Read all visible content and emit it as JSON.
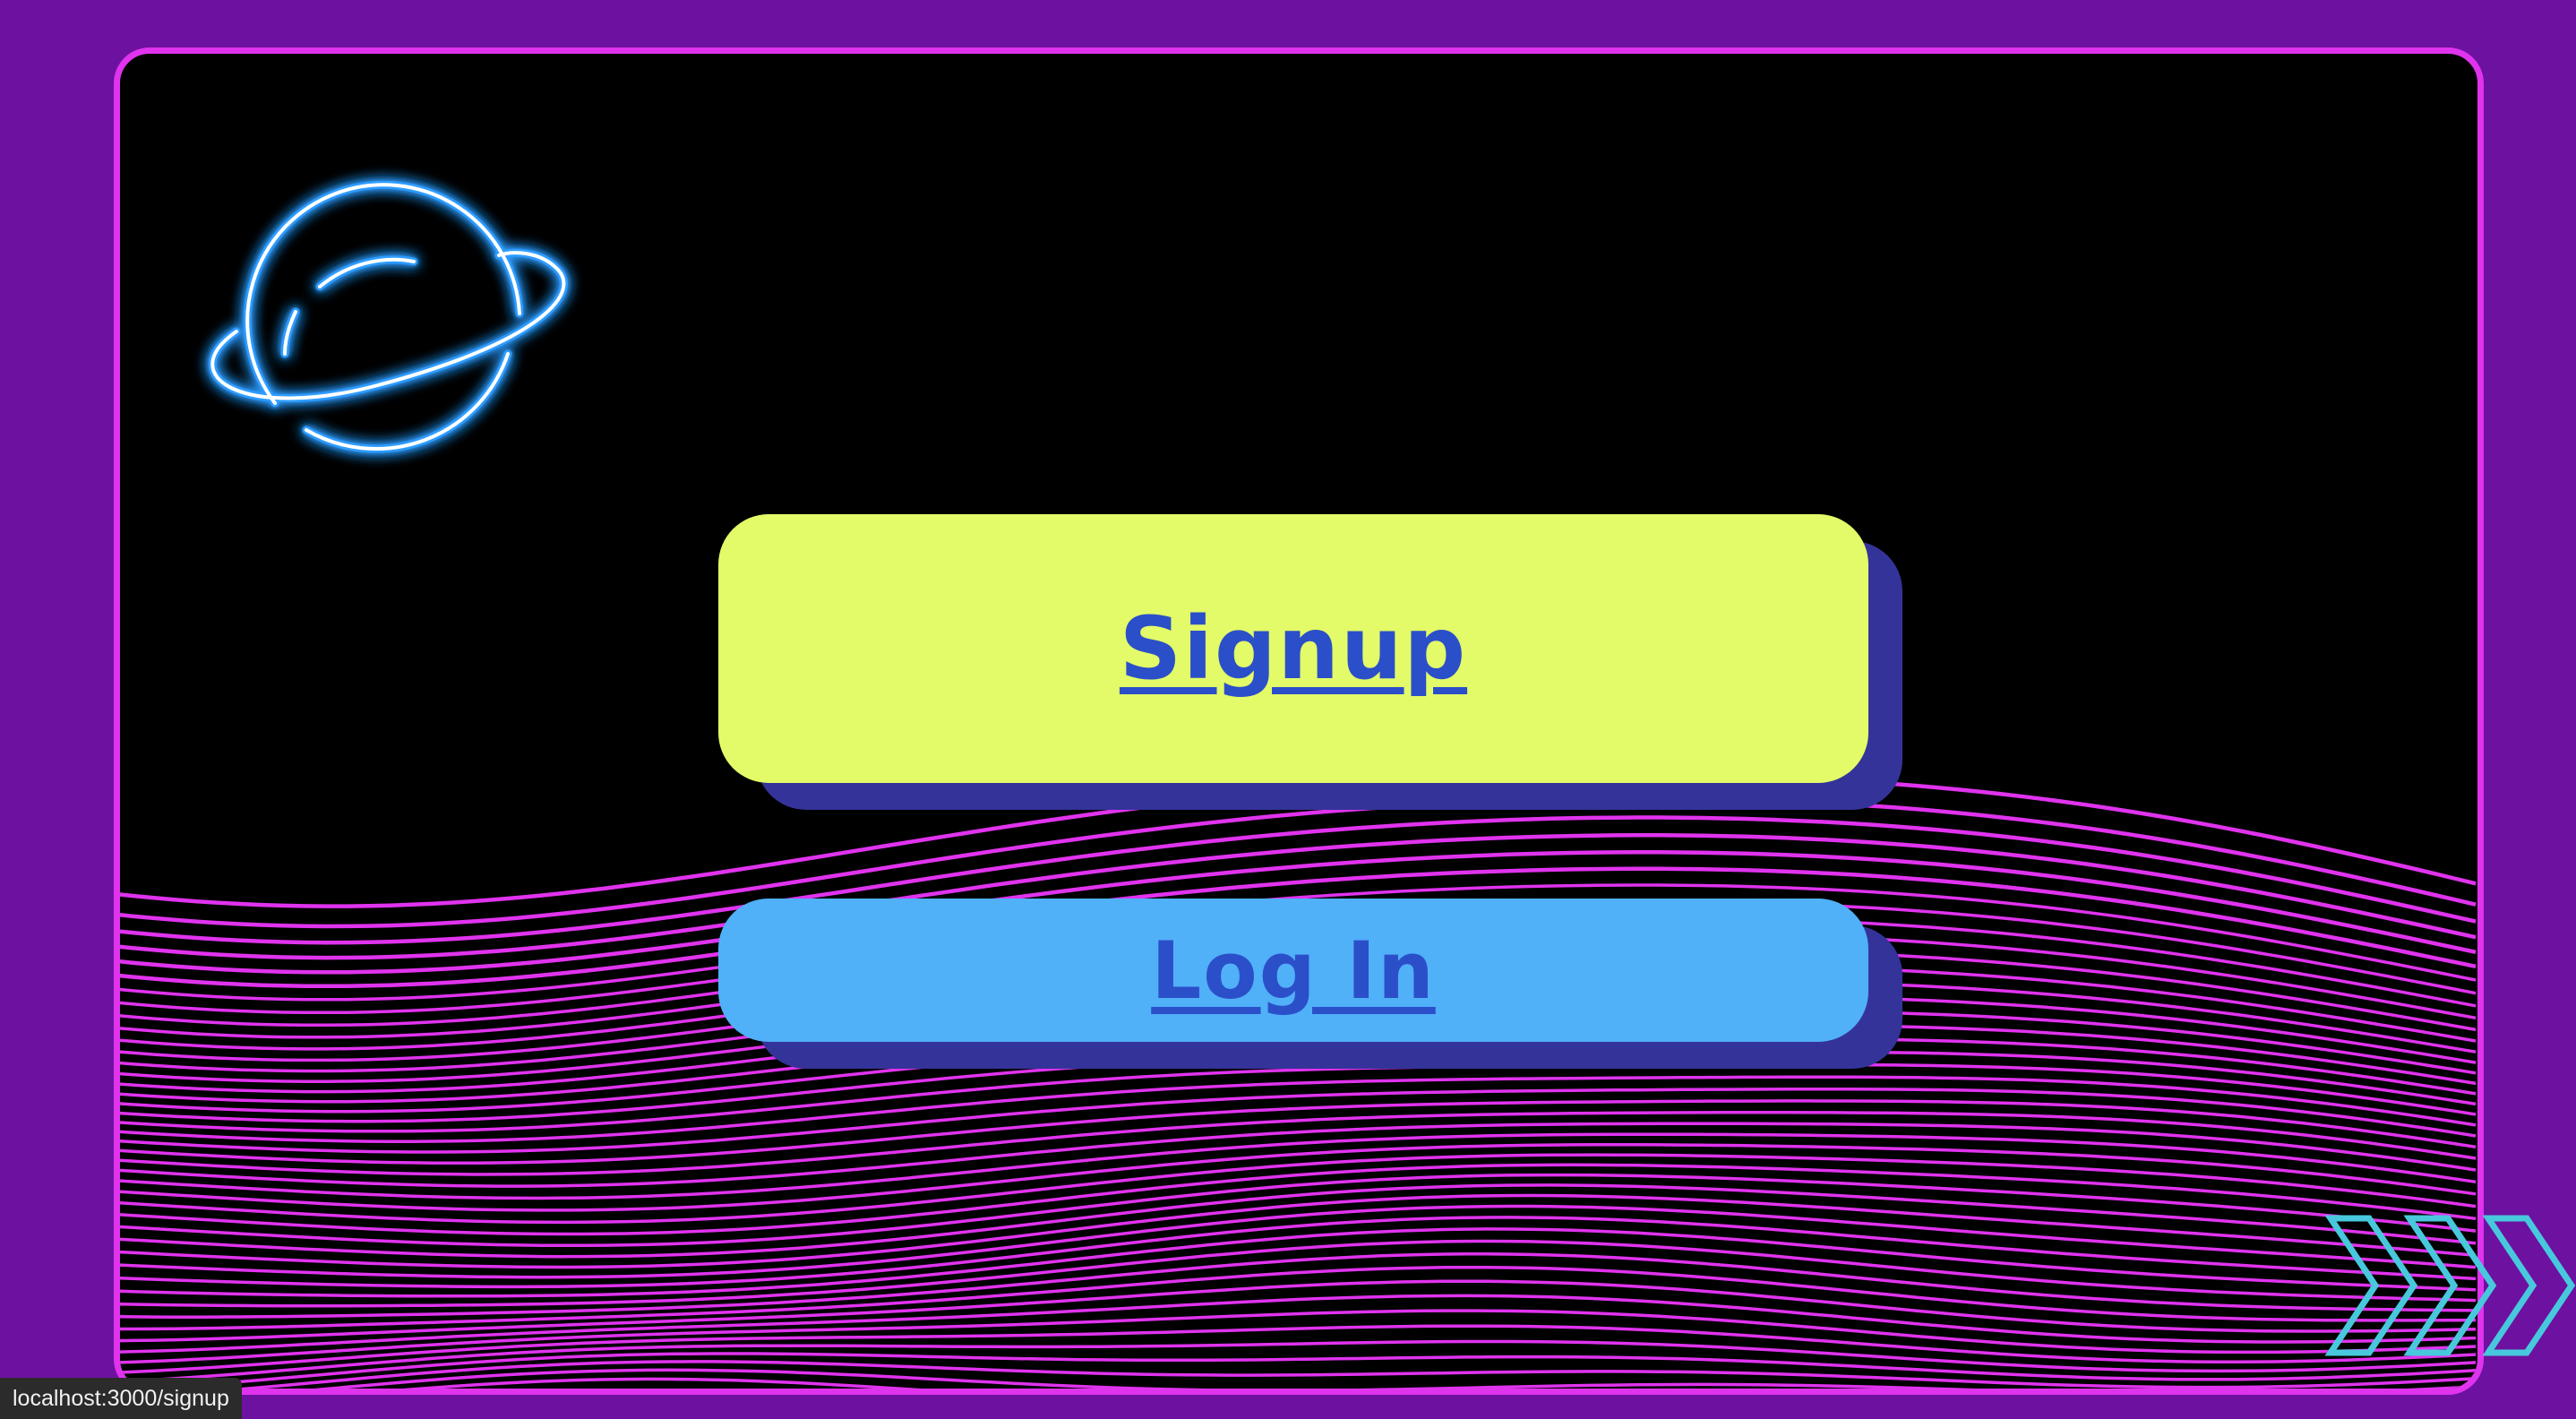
{
  "app": {
    "buttons": {
      "signup_label": "Signup",
      "login_label": "Log In"
    },
    "status_bar": {
      "url": "localhost:3000/signup"
    },
    "decorations": {
      "planet_icon": "neon-planet-icon",
      "chevrons_icon": "neon-chevrons-icon"
    },
    "colors": {
      "outer_bg": "#6d11a0",
      "frame_border": "#e033ee",
      "wave_lines": "#e033ee",
      "signup_bg": "#e3fb68",
      "login_bg": "#50b0f8",
      "button_shadow": "#343399",
      "button_text": "#2b4fc9",
      "neon_planet": "#7fd0ff",
      "neon_chevrons": "#48c8dc"
    }
  }
}
